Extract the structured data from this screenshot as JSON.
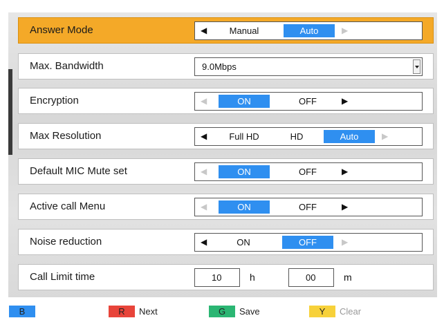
{
  "settings": {
    "answer_mode": {
      "label": "Answer Mode",
      "options": [
        "Manual",
        "Auto"
      ],
      "selected": "Auto"
    },
    "max_bandwidth": {
      "label": "Max. Bandwidth",
      "value": "9.0Mbps"
    },
    "encryption": {
      "label": "Encryption",
      "options": [
        "ON",
        "OFF"
      ],
      "selected": "ON"
    },
    "max_resolution": {
      "label": "Max Resolution",
      "options": [
        "Full HD",
        "HD",
        "Auto"
      ],
      "selected": "Auto"
    },
    "default_mic_mute": {
      "label": "Default MIC Mute set",
      "options": [
        "ON",
        "OFF"
      ],
      "selected": "ON"
    },
    "active_call_menu": {
      "label": "Active call Menu",
      "options": [
        "ON",
        "OFF"
      ],
      "selected": "ON"
    },
    "noise_reduction": {
      "label": "Noise reduction",
      "options": [
        "ON",
        "OFF"
      ],
      "selected": "OFF"
    },
    "call_limit_time": {
      "label": "Call Limit time",
      "hours": "10",
      "hours_unit": "h",
      "minutes": "00",
      "minutes_unit": "m"
    }
  },
  "footer": {
    "blue": {
      "key": "B",
      "label": "",
      "color": "#2f8ff0"
    },
    "red": {
      "key": "R",
      "label": "Next",
      "color": "#e8443a"
    },
    "green": {
      "key": "G",
      "label": "Save",
      "color": "#2bb673"
    },
    "yellow": {
      "key": "Y",
      "label": "Clear",
      "color": "#f7d13a"
    }
  },
  "colors": {
    "selected_row": "#f4a928",
    "active_option": "#2f8ff0"
  },
  "icons": {
    "left": "triangle-left-icon",
    "right": "triangle-right-icon",
    "dropdown": "dropdown-arrow-icon"
  }
}
